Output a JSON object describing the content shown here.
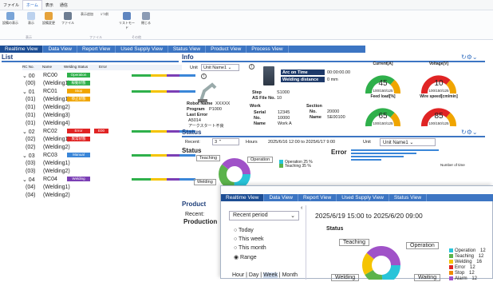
{
  "menu": {
    "items": [
      "ファイル",
      "ホーム",
      "表示",
      "通信"
    ],
    "active": "ホーム"
  },
  "ribbon": {
    "buttons": [
      "設備の表示",
      "表示",
      "設備変更",
      "ファイル",
      "表示追加",
      "1つ前",
      "戻る",
      "リストモード",
      "変更",
      "閉じる"
    ],
    "groups": [
      "表示",
      "ファイル",
      "その他"
    ]
  },
  "tabs": [
    "Realtime View",
    "Data View",
    "Report View",
    "Used Supply View",
    "Status View",
    "Product View",
    "Process View"
  ],
  "list": {
    "title": "List",
    "headers": [
      "RC No.",
      "Name",
      "Welding Status",
      "Error"
    ],
    "rows": [
      {
        "no": "00",
        "name": "RC00",
        "status": "Operation",
        "err": "",
        "color": "#2fb04b"
      },
      {
        "no": "(00)",
        "name": "(Welding1)",
        "status": "稼動状態",
        "err": "",
        "color": "#2fb04b"
      },
      {
        "no": "01",
        "name": "RC01",
        "status": "Stop",
        "err": "",
        "color": "#f0a500"
      },
      {
        "no": "(01)",
        "name": "(Welding1)",
        "status": "停止状態",
        "err": "",
        "color": "#f0a500"
      },
      {
        "no": "(01)",
        "name": "(Welding2)",
        "status": "",
        "err": "",
        "color": ""
      },
      {
        "no": "(01)",
        "name": "(Welding3)",
        "status": "",
        "err": "",
        "color": ""
      },
      {
        "no": "(01)",
        "name": "(Welding4)",
        "status": "",
        "err": "",
        "color": ""
      },
      {
        "no": "02",
        "name": "RC02",
        "status": "Error",
        "err": "E00",
        "color": "#e02424"
      },
      {
        "no": "(02)",
        "name": "(Welding1)",
        "status": "異常状態",
        "err": "",
        "color": "#e02424"
      },
      {
        "no": "(02)",
        "name": "(Welding2)",
        "status": "",
        "err": "",
        "color": ""
      },
      {
        "no": "03",
        "name": "RC03",
        "status": "Manual",
        "err": "",
        "color": "#3a86d8"
      },
      {
        "no": "(03)",
        "name": "(Welding1)",
        "status": "",
        "err": "",
        "color": ""
      },
      {
        "no": "(03)",
        "name": "(Welding2)",
        "status": "",
        "err": "",
        "color": ""
      },
      {
        "no": "04",
        "name": "RC04",
        "status": "Welding",
        "err": "",
        "color": "#7b3fb5"
      },
      {
        "no": "(04)",
        "name": "(Welding1)",
        "status": "",
        "err": "",
        "color": ""
      },
      {
        "no": "(04)",
        "name": "(Welding2)",
        "status": "",
        "err": "",
        "color": ""
      }
    ]
  },
  "info": {
    "title": "Info",
    "unit_label": "Unit",
    "unit_value": "Unit Name1",
    "arc_on_time_label": "Arc on Time",
    "arc_on_time": "00:00:00.00",
    "welding_distance_label": "Welding distance",
    "welding_distance": "0 mm",
    "step_label": "Step",
    "step": "S1000",
    "as_file_label": "AS File No.",
    "as_file": "10",
    "robot_name_label": "Robot Name",
    "robot_name": "XXXXX",
    "program_label": "Program",
    "program": "P1000",
    "last_error_label": "Last Error",
    "last_error": "A5014",
    "last_error_text": "アークスタート不良",
    "work_label": "Work",
    "serial_label": "Serial",
    "serial": "12345",
    "no_label": "No.",
    "no": "10000",
    "name_label": "Name",
    "name": "Work A",
    "section_label": "Section",
    "section_no_label": "No.",
    "section_no": "20000",
    "section_name_label": "Name",
    "section_name": "SE00100"
  },
  "gauges": [
    {
      "label": "Current[A]",
      "value": "45",
      "scale": "100/150/125",
      "color": "#2fb04b"
    },
    {
      "label": "Voltage[V]",
      "value": "10",
      "scale": "100/150/125",
      "color": "#e02424"
    },
    {
      "label": "Feed load[%]",
      "value": "65",
      "scale": "100/150/125",
      "color": "#2fb04b"
    },
    {
      "label": "Wire speed[cm/min]",
      "value": "85",
      "scale": "100/150/125",
      "color": "#e02424"
    }
  ],
  "status": {
    "title": "Status",
    "recent_label": "Recent:",
    "recent_value": "3",
    "hours_label": "Hours",
    "range": "2025/6/16 12:00 to 2025/6/17 9:00",
    "unit_label": "Unit",
    "unit_value": "Unit Name1",
    "chart_title": "Status",
    "teaching": "Teaching",
    "operation": "Operation",
    "welding": "Welding",
    "error_title": "Error",
    "legend": [
      "Operation 25 %",
      "Teaching 35 %"
    ],
    "number_of_time": "Number of time"
  },
  "product": {
    "title": "Product",
    "recent_label": "Recent:",
    "production": "Production"
  },
  "overlay": {
    "tabs": [
      "Realtime View",
      "Data View",
      "Report View",
      "Used Supply View",
      "Status View"
    ],
    "period_select": "Recent period",
    "options": [
      "Today",
      "This week",
      "This month",
      "Range"
    ],
    "selected": "Range",
    "granularity": [
      "Hour",
      "Day",
      "Week",
      "Month"
    ],
    "active_gran": "Week",
    "range": "2025/6/19 15:00 to 2025/6/20 09:00",
    "status_title": "Status",
    "teaching": "Teaching",
    "operation": "Operation",
    "welding": "Welding",
    "waiting": "Waiting",
    "legend": [
      {
        "name": "Operation",
        "color": "#29c4d9",
        "val": "12"
      },
      {
        "name": "Teaching",
        "color": "#5bb34b",
        "val": "12"
      },
      {
        "name": "Welding",
        "color": "#f5c400",
        "val": "16"
      },
      {
        "name": "Error",
        "color": "#e02424",
        "val": "12"
      },
      {
        "name": "Stop",
        "color": "#f08a00",
        "val": "12"
      },
      {
        "name": "Alarm",
        "color": "#a052c8",
        "val": "12"
      }
    ]
  }
}
